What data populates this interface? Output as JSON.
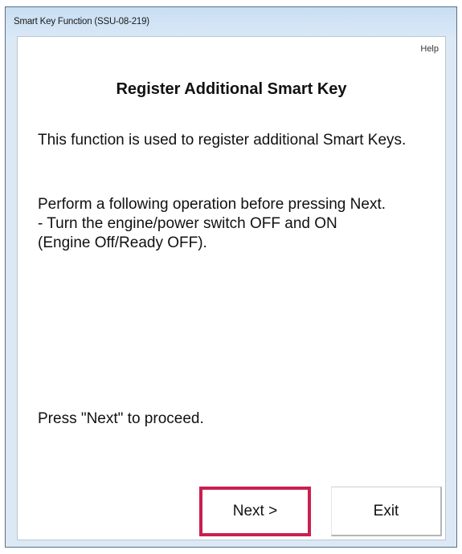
{
  "window": {
    "title": "Smart Key Function (SSU-08-219)"
  },
  "toolbar": {
    "help_label": "Help"
  },
  "dialog": {
    "heading": "Register Additional Smart Key",
    "description": "This function is used to register additional Smart Keys.",
    "instruction_line1": "Perform a following operation before pressing Next.",
    "instruction_line2": "- Turn the engine/power switch OFF and ON",
    "instruction_line3": "(Engine Off/Ready OFF).",
    "prompt": "Press \"Next\" to proceed."
  },
  "buttons": {
    "next_label": "Next >",
    "exit_label": "Exit"
  },
  "colors": {
    "titlebar": "#c9def2",
    "highlight_border": "#c9204f"
  }
}
